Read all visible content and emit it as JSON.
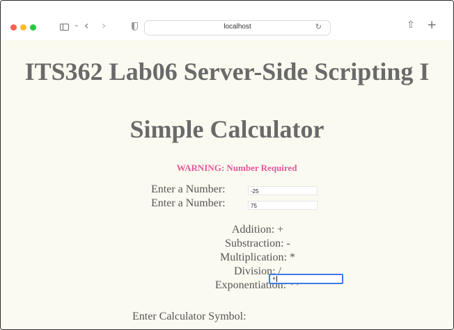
{
  "browser": {
    "address": "localhost"
  },
  "page": {
    "title": "ITS362 Lab06 Server-Side Scripting I",
    "subtitle": "Simple Calculator",
    "warning": "WARNING: Number Required",
    "fields": [
      {
        "label": "Enter a Number:",
        "value": "-25"
      },
      {
        "label": "Enter a Number:",
        "value": "75"
      }
    ],
    "operations": [
      "Addition: +",
      "Substraction: -",
      "Multiplication: *",
      "Division: /",
      "Exponentiation: **"
    ],
    "symbol_label": "Enter Calculator Symbol:",
    "symbol_value": "+"
  },
  "colors": {
    "page_background": "#fbfaf0",
    "heading": "#6a6a6a",
    "warning": "#e4589a",
    "focus_ring": "#3a7be6"
  },
  "icons": [
    "sidebar-icon",
    "chevron-down-icon",
    "back-arrow-icon",
    "forward-arrow-icon",
    "shield-icon",
    "reload-icon",
    "share-icon",
    "new-tab-icon"
  ]
}
